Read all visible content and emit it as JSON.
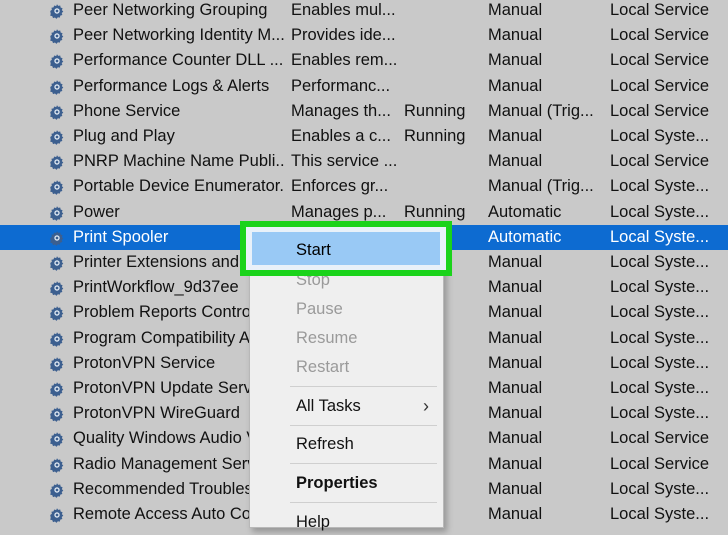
{
  "services": [
    {
      "name": "Peer Networking Grouping",
      "description": "Enables mul...",
      "status": "",
      "startup": "Manual",
      "logon": "Local Service"
    },
    {
      "name": "Peer Networking Identity M...",
      "description": "Provides ide...",
      "status": "",
      "startup": "Manual",
      "logon": "Local Service"
    },
    {
      "name": "Performance Counter DLL ...",
      "description": "Enables rem...",
      "status": "",
      "startup": "Manual",
      "logon": "Local Service"
    },
    {
      "name": "Performance Logs & Alerts",
      "description": "Performanc...",
      "status": "",
      "startup": "Manual",
      "logon": "Local Service"
    },
    {
      "name": "Phone Service",
      "description": "Manages th...",
      "status": "Running",
      "startup": "Manual (Trig...",
      "logon": "Local Service"
    },
    {
      "name": "Plug and Play",
      "description": "Enables a c...",
      "status": "Running",
      "startup": "Manual",
      "logon": "Local Syste..."
    },
    {
      "name": "PNRP Machine Name Publi...",
      "description": "This service ...",
      "status": "",
      "startup": "Manual",
      "logon": "Local Service"
    },
    {
      "name": "Portable Device Enumerator...",
      "description": "Enforces gr...",
      "status": "",
      "startup": "Manual (Trig...",
      "logon": "Local Syste..."
    },
    {
      "name": "Power",
      "description": "Manages p...",
      "status": "Running",
      "startup": "Automatic",
      "logon": "Local Syste..."
    },
    {
      "name": "Print Spooler",
      "description": "",
      "status": "",
      "startup": "Automatic",
      "logon": "Local Syste...",
      "selected": true
    },
    {
      "name": "Printer Extensions and N",
      "description": "",
      "status": "",
      "startup": "Manual",
      "logon": "Local Syste..."
    },
    {
      "name": "PrintWorkflow_9d37ee",
      "description": "",
      "status": "ng",
      "startup": "Manual",
      "logon": "Local Syste..."
    },
    {
      "name": "Problem Reports Control",
      "description": "",
      "status": "",
      "startup": "Manual",
      "logon": "Local Syste..."
    },
    {
      "name": "Program Compatibility A",
      "description": "",
      "status": "ng",
      "startup": "Manual",
      "logon": "Local Syste..."
    },
    {
      "name": "ProtonVPN Service",
      "description": "",
      "status": "",
      "startup": "Manual",
      "logon": "Local Syste..."
    },
    {
      "name": "ProtonVPN Update Servic",
      "description": "",
      "status": "",
      "startup": "Manual",
      "logon": "Local Syste..."
    },
    {
      "name": "ProtonVPN WireGuard",
      "description": "",
      "status": "",
      "startup": "Manual",
      "logon": "Local Syste..."
    },
    {
      "name": "Quality Windows Audio V",
      "description": "",
      "status": "",
      "startup": "Manual",
      "logon": "Local Service"
    },
    {
      "name": "Radio Management Servi",
      "description": "",
      "status": "ng",
      "startup": "Manual",
      "logon": "Local Service"
    },
    {
      "name": "Recommended Troublesh",
      "description": "",
      "status": "",
      "startup": "Manual",
      "logon": "Local Syste..."
    },
    {
      "name": "Remote Access Auto Con",
      "description": "",
      "status": "",
      "startup": "Manual",
      "logon": "Local Syste..."
    }
  ],
  "context_menu": {
    "start": "Start",
    "stop": "Stop",
    "pause": "Pause",
    "resume": "Resume",
    "restart": "Restart",
    "all_tasks": "All Tasks",
    "refresh": "Refresh",
    "properties": "Properties",
    "help": "Help"
  },
  "colors": {
    "selection": "#0d6bd1",
    "highlight_border": "#1bd31b",
    "menu_hover": "#99c9f5"
  }
}
